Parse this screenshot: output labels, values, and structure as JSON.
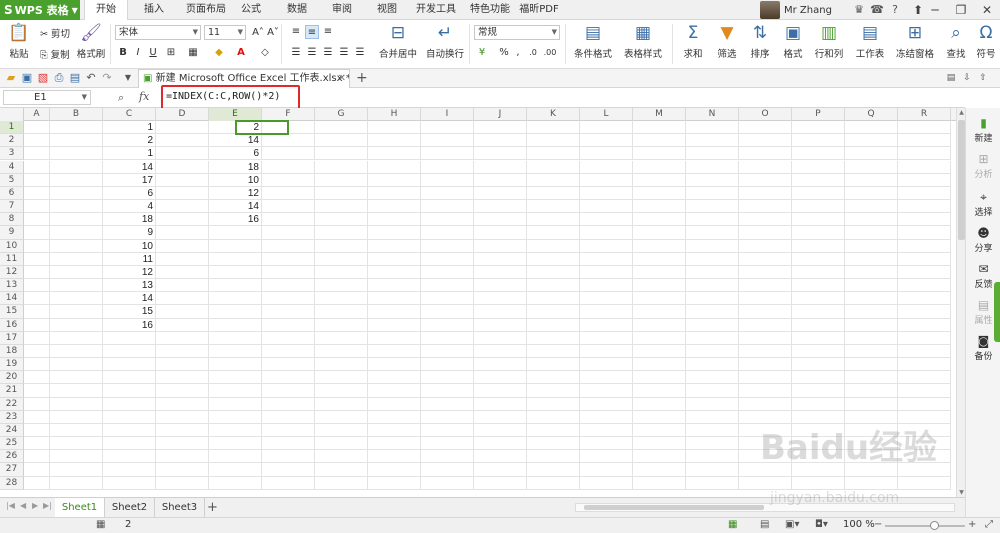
{
  "app": {
    "name": "WPS 表格",
    "logo": "S"
  },
  "menu_tabs": [
    "开始",
    "插入",
    "页面布局",
    "公式",
    "数据",
    "审阅",
    "视图",
    "开发工具",
    "特色功能",
    "福昕PDF"
  ],
  "user": {
    "name": "Mr Zhang"
  },
  "ribbon": {
    "clipboard": {
      "paste": "粘贴",
      "cut": "剪切",
      "copy": "复制",
      "format_painter": "格式刷"
    },
    "font_name": "宋体",
    "font_size": "11",
    "merge_center": "合并居中",
    "wrap_text": "自动换行",
    "number_format": "常规",
    "cond_format": "条件格式",
    "table_style": "表格样式",
    "sum": "求和",
    "filter": "筛选",
    "sort": "排序",
    "format": "格式",
    "row_col": "行和列",
    "worksheet": "工作表",
    "freeze": "冻结窗格",
    "find": "查找",
    "symbol": "符号"
  },
  "file_tab": "新建 Microsoft Office Excel 工作表.xlsx *",
  "formula_bar": {
    "cell_ref": "E1",
    "fx": "fx",
    "formula": "=INDEX(C:C,ROW()*2)"
  },
  "columns": [
    "A",
    "B",
    "C",
    "D",
    "E",
    "F",
    "G",
    "H",
    "I",
    "J",
    "K",
    "L",
    "M",
    "N",
    "O",
    "P",
    "Q",
    "R"
  ],
  "rows": [
    "1",
    "2",
    "3",
    "4",
    "5",
    "6",
    "7",
    "8",
    "9",
    "10",
    "11",
    "12",
    "13",
    "14",
    "15",
    "16",
    "17",
    "18",
    "19",
    "20",
    "21",
    "22",
    "23",
    "24",
    "25",
    "26",
    "27",
    "28"
  ],
  "col_c": [
    "1",
    "2",
    "1",
    "14",
    "17",
    "6",
    "4",
    "18",
    "9",
    "10",
    "11",
    "12",
    "13",
    "14",
    "15",
    "16"
  ],
  "col_e": [
    "2",
    "14",
    "6",
    "18",
    "10",
    "12",
    "14",
    "16"
  ],
  "sheets": [
    "Sheet1",
    "Sheet2",
    "Sheet3"
  ],
  "status": {
    "count": "2",
    "zoom": "100 %"
  },
  "side_panel": [
    "新建",
    "分析",
    "选择",
    "分享",
    "反馈",
    "属性",
    "备份"
  ],
  "watermark": {
    "text": "Baidu经验",
    "sub": "jingyan.baidu.com"
  },
  "accent": "#4aa02c"
}
